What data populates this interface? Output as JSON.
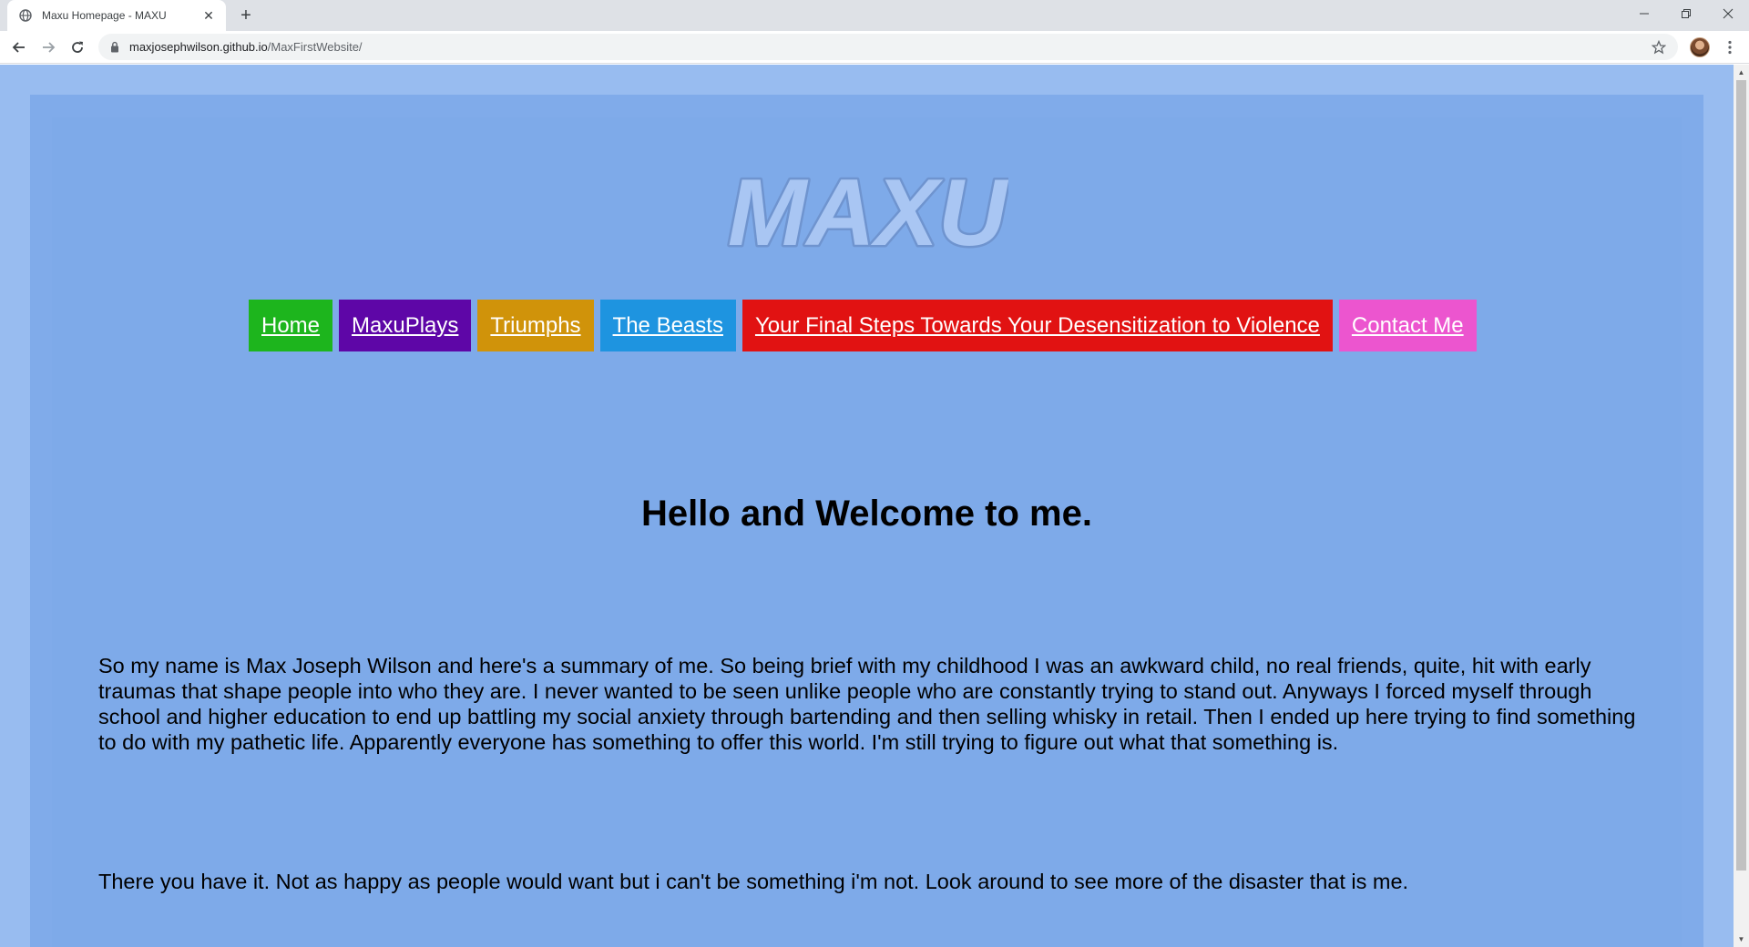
{
  "browser": {
    "tab_title": "Maxu Homepage - MAXU",
    "url_host": "maxjosephwilson.github.io",
    "url_path": "/MaxFirstWebsite/"
  },
  "page": {
    "logo_text": "MAXU",
    "nav": [
      {
        "label": "Home",
        "color": "#1db51d"
      },
      {
        "label": "MaxuPlays",
        "color": "#5e06a7"
      },
      {
        "label": "Triumphs",
        "color": "#d0930a"
      },
      {
        "label": "The Beasts",
        "color": "#1e94e0"
      },
      {
        "label": "Your Final Steps Towards Your Desensitization to Violence",
        "color": "#e11212"
      },
      {
        "label": "Contact Me",
        "color": "#ec55cf"
      }
    ],
    "heading": "Hello and Welcome to me.",
    "paragraph_1": "So my name is Max Joseph Wilson and here's a summary of me. So being brief with my childhood I was an awkward child, no real friends, quite, hit with early traumas that shape people into who they are. I never wanted to be seen unlike people who are constantly trying to stand out. Anyways I forced myself through school and higher education to end up battling my social anxiety through bartending and then selling whisky in retail. Then I ended up here trying to find something to do with my pathetic life. Apparently everyone has something to offer this world. I'm still trying to figure out what that something is.",
    "paragraph_2": "There you have it. Not as happy as people would want but i can't be something i'm not. Look around to see more of the disaster that is me."
  },
  "colors": {
    "page_background": "#98bcf0",
    "content_background": "#80abea",
    "logo_fill": "#a9c6f3",
    "logo_outline": "#6f94cf"
  },
  "icons": {
    "tab_favicon": "globe-icon",
    "back": "arrow-left-icon",
    "forward": "arrow-right-icon",
    "reload": "reload-icon",
    "secure": "lock-icon",
    "bookmark": "star-icon",
    "menu": "vertical-dots-icon"
  }
}
